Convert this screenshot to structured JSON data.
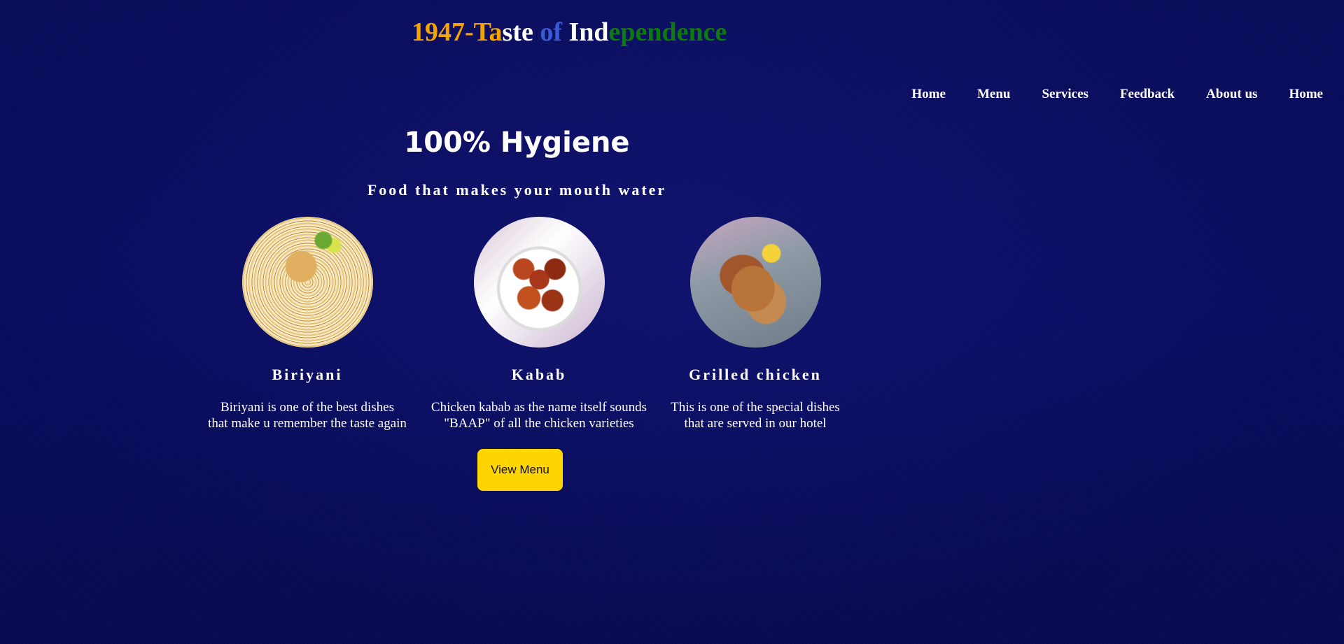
{
  "header": {
    "title_parts": [
      "1947-",
      "Ta",
      "ste ",
      "of ",
      "Ind",
      "ependence"
    ]
  },
  "nav": {
    "items": [
      {
        "label": "Home"
      },
      {
        "label": "Menu"
      },
      {
        "label": "Services"
      },
      {
        "label": "Feedback"
      },
      {
        "label": "About us"
      },
      {
        "label": "Home"
      }
    ]
  },
  "hero": {
    "heading": "100% Hygiene",
    "tagline": "Food that makes your mouth water"
  },
  "dishes": [
    {
      "name": "Biriyani",
      "description": "Biriyani is one of the best dishes\nthat make u remember the taste again"
    },
    {
      "name": "Kabab",
      "description": "Chicken kabab as the name itself sounds\n\"BAAP\" of all the chicken varieties"
    },
    {
      "name": "Grilled chicken",
      "description": "This is one of the special dishes\nthat are served in our hotel"
    }
  ],
  "actions": {
    "view_menu_label": "View Menu"
  },
  "colors": {
    "background": "#060a5e",
    "saffron": "#f4a300",
    "blue": "#3a5bd8",
    "green": "#0d7a0d",
    "button": "#ffd500"
  }
}
